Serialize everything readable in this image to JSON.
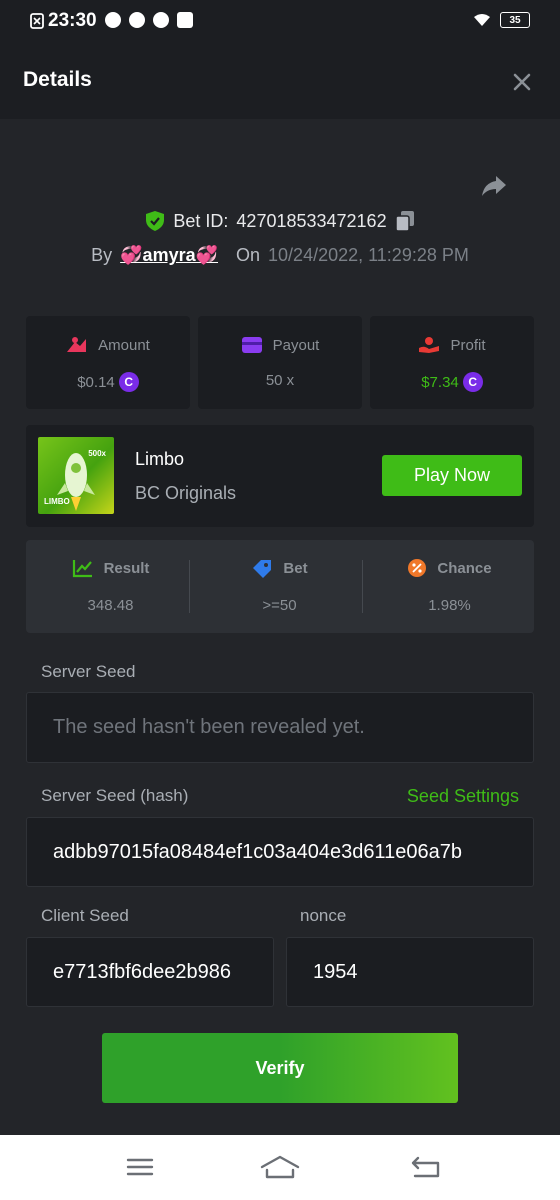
{
  "status_bar": {
    "time": "23:30",
    "battery": "35"
  },
  "header": {
    "title": "Details"
  },
  "bet": {
    "id_label": "Bet ID:",
    "id_value": "427018533472162",
    "by_label": "By",
    "user": "💞amyra💞",
    "on_label": "On",
    "date": "10/24/2022, 11:29:28 PM"
  },
  "stats": [
    {
      "label": "Amount",
      "value": "$0.14",
      "value_color": "#8b9096",
      "coin": true,
      "icon": "amount-icon"
    },
    {
      "label": "Payout",
      "value": "50 x",
      "value_color": "#8b9096",
      "coin": false,
      "icon": "wallet-icon"
    },
    {
      "label": "Profit",
      "value": "$7.34",
      "value_color": "#3fbc17",
      "coin": true,
      "icon": "profit-icon"
    }
  ],
  "game": {
    "name": "Limbo",
    "provider": "BC Originals",
    "play_label": "Play Now",
    "thumb_tag": "500x",
    "thumb_title": "LIMBO"
  },
  "results": [
    {
      "label": "Result",
      "value": "348.48",
      "icon": "chart-icon"
    },
    {
      "label": "Bet",
      "value": ">=50",
      "icon": "tag-icon"
    },
    {
      "label": "Chance",
      "value": "1.98%",
      "icon": "percent-icon"
    }
  ],
  "server_seed": {
    "label": "Server Seed",
    "value": "The seed hasn't been revealed yet."
  },
  "server_seed_hash": {
    "label": "Server Seed (hash)",
    "settings_label": "Seed Settings",
    "value": "adbb97015fa08484ef1c03a404e3d611e06a7b"
  },
  "client_seed": {
    "label": "Client Seed",
    "value": "e7713fbf6dee2b986"
  },
  "nonce": {
    "label": "nonce",
    "value": "1954"
  },
  "verify_label": "Verify",
  "colors": {
    "accent": "#3fbc17",
    "coin": "#7a2ce8",
    "background": "#232529"
  }
}
